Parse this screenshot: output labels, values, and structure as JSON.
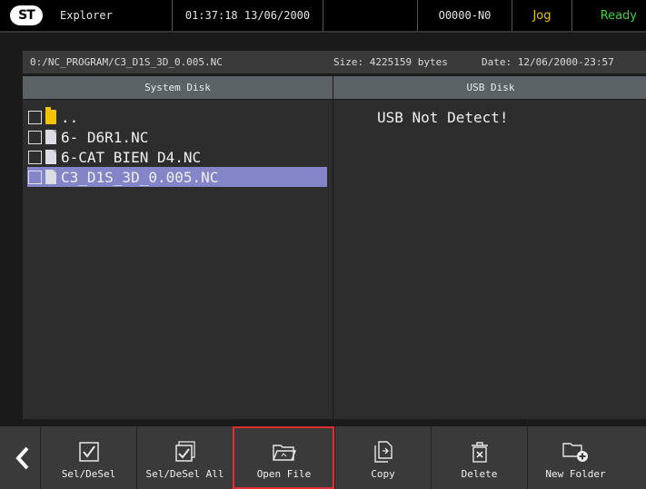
{
  "topbar": {
    "logo_text": "ST",
    "title": "Explorer",
    "clock": "01:37:18 13/06/2000",
    "program": "O0000-N0",
    "mode": "Jog",
    "status": "Ready",
    "mode_color": "#e8c400",
    "status_color": "#3fd03f"
  },
  "info": {
    "path": "0:/NC_PROGRAM/C3_D1S_3D_0.005.NC",
    "size": "Size: 4225159 bytes",
    "date": "Date: 12/06/2000-23:57"
  },
  "panels": {
    "left_title": "System Disk",
    "right_title": "USB Disk",
    "usb_message": "USB Not Detect!"
  },
  "files": [
    {
      "name": "..",
      "type": "folder-icon",
      "selected": false
    },
    {
      "name": "6- D6R1.NC",
      "type": "file-icon",
      "selected": false
    },
    {
      "name": "6-CAT BIEN D4.NC",
      "type": "file-icon",
      "selected": false
    },
    {
      "name": "C3_D1S_3D_0.005.NC",
      "type": "file-icon",
      "selected": true
    }
  ],
  "toolbar": {
    "sel_desel": "Sel/DeSel",
    "sel_desel_all": "Sel/DeSel All",
    "open_file": "Open File",
    "copy": "Copy",
    "delete": "Delete",
    "new_folder": "New Folder",
    "active_color": "#e03030"
  }
}
